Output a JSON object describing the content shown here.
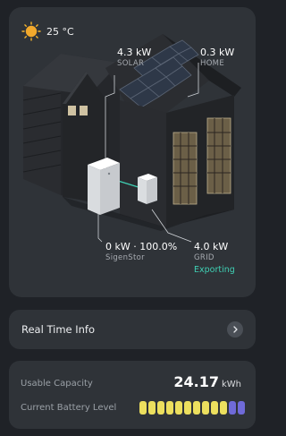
{
  "weather": {
    "temperature": "25 °C",
    "icon": "sun-icon"
  },
  "solar": {
    "value": "4.3 kW",
    "caption": "SOLAR"
  },
  "home": {
    "value": "0.3 kW",
    "caption": "HOME"
  },
  "sigenstor": {
    "value": "0 kW · 100.0%",
    "caption": "SigenStor"
  },
  "grid": {
    "value": "4.0 kW",
    "caption": "GRID",
    "status": "Exporting"
  },
  "info": {
    "label": "Real Time Info",
    "icon": "chevron-right-icon"
  },
  "battery": {
    "capacity_label": "Usable Capacity",
    "capacity_value": "24.17",
    "capacity_unit": "kWh",
    "level_label": "Current Battery Level",
    "segments_total": 12,
    "segments_filled": 10
  },
  "colors": {
    "background": "#1f2227",
    "card": "#2f3338",
    "accent_teal": "#3fd0b4",
    "battery_yellow": "#ecdf5e",
    "battery_purple": "#6f6ad8"
  }
}
